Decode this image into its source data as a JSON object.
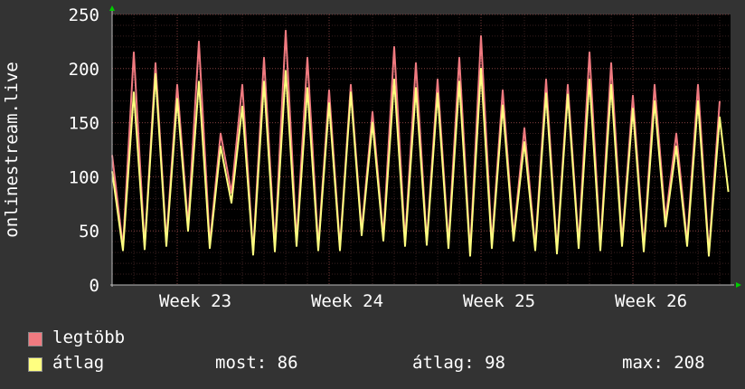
{
  "chart_data": {
    "type": "line",
    "ylabel": "onlinestream.live",
    "ylim": [
      0,
      250
    ],
    "yticks": [
      0,
      50,
      100,
      150,
      200,
      250
    ],
    "xticks": [
      "Week 23",
      "Week 24",
      "Week 25",
      "Week 26"
    ],
    "grid": true,
    "x_start_day": 0,
    "x_end_day": 28.5,
    "series": [
      {
        "name": "legtöbb",
        "color": "#f07a80",
        "values": [
          [
            0,
            120
          ],
          [
            0.5,
            35
          ],
          [
            1,
            215
          ],
          [
            1.5,
            35
          ],
          [
            2,
            205
          ],
          [
            2.5,
            40
          ],
          [
            3,
            185
          ],
          [
            3.5,
            55
          ],
          [
            4,
            225
          ],
          [
            4.5,
            38
          ],
          [
            5,
            140
          ],
          [
            5.5,
            85
          ],
          [
            6,
            185
          ],
          [
            6.5,
            30
          ],
          [
            7,
            210
          ],
          [
            7.5,
            35
          ],
          [
            8,
            235
          ],
          [
            8.5,
            40
          ],
          [
            9,
            210
          ],
          [
            9.5,
            35
          ],
          [
            10,
            180
          ],
          [
            10.5,
            35
          ],
          [
            11,
            185
          ],
          [
            11.5,
            50
          ],
          [
            12,
            160
          ],
          [
            12.5,
            45
          ],
          [
            13,
            220
          ],
          [
            13.5,
            40
          ],
          [
            14,
            205
          ],
          [
            14.5,
            40
          ],
          [
            15,
            190
          ],
          [
            15.5,
            38
          ],
          [
            16,
            210
          ],
          [
            16.5,
            30
          ],
          [
            17,
            230
          ],
          [
            17.5,
            38
          ],
          [
            18,
            180
          ],
          [
            18.5,
            45
          ],
          [
            19,
            145
          ],
          [
            19.5,
            35
          ],
          [
            20,
            190
          ],
          [
            20.5,
            32
          ],
          [
            21,
            185
          ],
          [
            21.5,
            38
          ],
          [
            22,
            215
          ],
          [
            22.5,
            35
          ],
          [
            23,
            205
          ],
          [
            23.5,
            40
          ],
          [
            24,
            175
          ],
          [
            24.5,
            35
          ],
          [
            25,
            185
          ],
          [
            25.5,
            60
          ],
          [
            26,
            140
          ],
          [
            26.5,
            40
          ],
          [
            27,
            185
          ],
          [
            27.5,
            30
          ],
          [
            28,
            170
          ]
        ]
      },
      {
        "name": "átlag",
        "color": "#ffff80",
        "values": [
          [
            0,
            105
          ],
          [
            0.5,
            32
          ],
          [
            1,
            178
          ],
          [
            1.5,
            33
          ],
          [
            2,
            195
          ],
          [
            2.5,
            36
          ],
          [
            3,
            172
          ],
          [
            3.5,
            50
          ],
          [
            4,
            188
          ],
          [
            4.5,
            34
          ],
          [
            5,
            128
          ],
          [
            5.5,
            76
          ],
          [
            6,
            165
          ],
          [
            6.5,
            28
          ],
          [
            7,
            188
          ],
          [
            7.5,
            31
          ],
          [
            8,
            198
          ],
          [
            8.5,
            36
          ],
          [
            9,
            182
          ],
          [
            9.5,
            32
          ],
          [
            10,
            168
          ],
          [
            10.5,
            32
          ],
          [
            11,
            178
          ],
          [
            11.5,
            46
          ],
          [
            12,
            150
          ],
          [
            12.5,
            41
          ],
          [
            13,
            190
          ],
          [
            13.5,
            36
          ],
          [
            14,
            182
          ],
          [
            14.5,
            37
          ],
          [
            15,
            177
          ],
          [
            15.5,
            34
          ],
          [
            16,
            188
          ],
          [
            16.5,
            27
          ],
          [
            17,
            200
          ],
          [
            17.5,
            34
          ],
          [
            18,
            166
          ],
          [
            18.5,
            41
          ],
          [
            19,
            132
          ],
          [
            19.5,
            32
          ],
          [
            20,
            177
          ],
          [
            20.5,
            29
          ],
          [
            21,
            176
          ],
          [
            21.5,
            34
          ],
          [
            22,
            190
          ],
          [
            22.5,
            32
          ],
          [
            23,
            185
          ],
          [
            23.5,
            36
          ],
          [
            24,
            163
          ],
          [
            24.5,
            31
          ],
          [
            25,
            170
          ],
          [
            25.5,
            54
          ],
          [
            26,
            128
          ],
          [
            26.5,
            36
          ],
          [
            27,
            170
          ],
          [
            27.5,
            27
          ],
          [
            28,
            155
          ],
          [
            28.4,
            86
          ]
        ]
      }
    ],
    "legend": [
      {
        "label": "legtöbb",
        "color": "#f07a80"
      },
      {
        "label": "átlag",
        "color": "#ffff80"
      }
    ],
    "stats": {
      "most": "most: 86",
      "atlag": "átlag: 98",
      "max": "max: 208"
    }
  }
}
